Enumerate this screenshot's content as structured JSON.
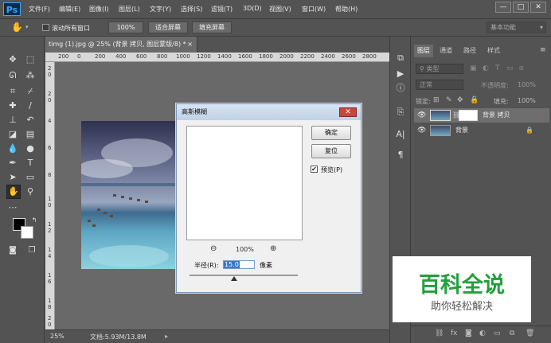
{
  "app": {
    "logo": "Ps"
  },
  "menu": [
    "文件(F)",
    "编辑(E)",
    "图像(I)",
    "图层(L)",
    "文字(Y)",
    "选择(S)",
    "滤镜(T)",
    "3D(D)",
    "视图(V)",
    "窗口(W)",
    "帮助(H)"
  ],
  "window_controls": {
    "minimize": "—",
    "restore": "□",
    "close": "✕"
  },
  "options_bar": {
    "scroll_all_windows": "滚动所有窗口",
    "zoom_100": "100%",
    "fit_screen": "适合屏幕",
    "fill_screen": "填充屏幕",
    "workspace": "基本功能"
  },
  "document": {
    "tab_title": "timg (1).jpg @ 25% (背景 拷贝, 图层蒙版/8) *",
    "tab_close": "×",
    "ruler_h_labels": [
      "200",
      "0",
      "200",
      "400",
      "600",
      "800",
      "1000",
      "1200",
      "1400",
      "1600",
      "1800",
      "2000",
      "2200",
      "2400",
      "2600",
      "2800"
    ],
    "ruler_v_labels": [
      "2",
      "0",
      "2",
      "0",
      "4",
      "6",
      "8",
      "1",
      "0",
      "1",
      "2",
      "1",
      "4",
      "1",
      "6",
      "1",
      "8",
      "2",
      "0"
    ],
    "status_zoom": "25%",
    "status_doc": "文档:5.93M/13.8M"
  },
  "dialog": {
    "title": "高斯模糊",
    "ok": "确定",
    "reset": "复位",
    "preview_label": "预览(P)",
    "zoom_value": "100%",
    "radius_label": "半径(R):",
    "radius_value": "15.0",
    "radius_unit": "像素"
  },
  "layers_panel": {
    "tabs": [
      "图层",
      "通道",
      "路径",
      "样式"
    ],
    "kind_filter": "类型",
    "blend_mode": "正常",
    "opacity_label": "不透明度:",
    "opacity_value": "100%",
    "lock_label": "锁定:",
    "fill_label": "填充:",
    "fill_value": "100%",
    "layers": [
      {
        "name": "背景 拷贝",
        "selected": true
      },
      {
        "name": "背景",
        "selected": false
      }
    ]
  },
  "watermark": {
    "title": "百科全说",
    "subtitle": "助你轻松解决"
  },
  "colors": {
    "ui_bg": "#535353",
    "canvas_bg": "#696969",
    "accent_green": "#21a03b",
    "selection_blue": "#3a74d0"
  }
}
